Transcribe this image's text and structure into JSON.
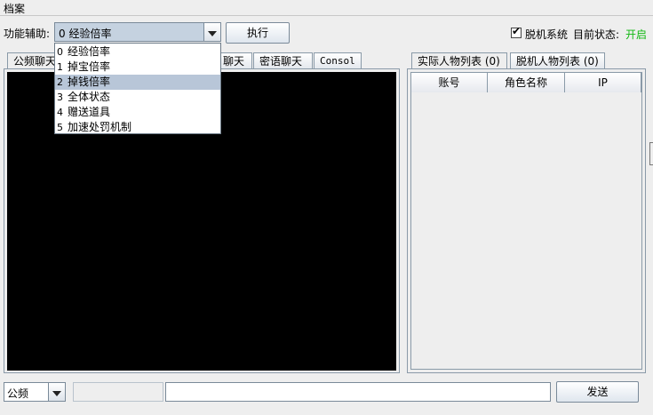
{
  "menu": {
    "archive": "档案"
  },
  "toolbar": {
    "function_label": "功能辅助:",
    "selected_value": "0 经验倍率",
    "execute_button": "执行",
    "offline_checkbox_label": "脱机系统",
    "offline_checked": true,
    "status_label": "目前状态:",
    "status_value": "开启",
    "status_color": "#12b812"
  },
  "dropdown": {
    "items": [
      {
        "idx": "0",
        "label": "经验倍率"
      },
      {
        "idx": "1",
        "label": "掉宝倍率"
      },
      {
        "idx": "2",
        "label": "掉钱倍率"
      },
      {
        "idx": "3",
        "label": "全体状态"
      },
      {
        "idx": "4",
        "label": "赠送道具"
      },
      {
        "idx": "5",
        "label": "加速处罚机制"
      }
    ],
    "highlighted_index": 2
  },
  "chat_tabs": [
    {
      "label": "公频聊天"
    },
    {
      "label": "聊天"
    },
    {
      "label": "密语聊天"
    },
    {
      "label": "Consol"
    }
  ],
  "player_tabs": [
    {
      "label": "实际人物列表 (0)"
    },
    {
      "label": "脱机人物列表 (0)"
    }
  ],
  "table": {
    "headers": [
      "账号",
      "角色名称",
      "IP"
    ]
  },
  "footer": {
    "channel_value": "公频",
    "send_button": "发送"
  }
}
